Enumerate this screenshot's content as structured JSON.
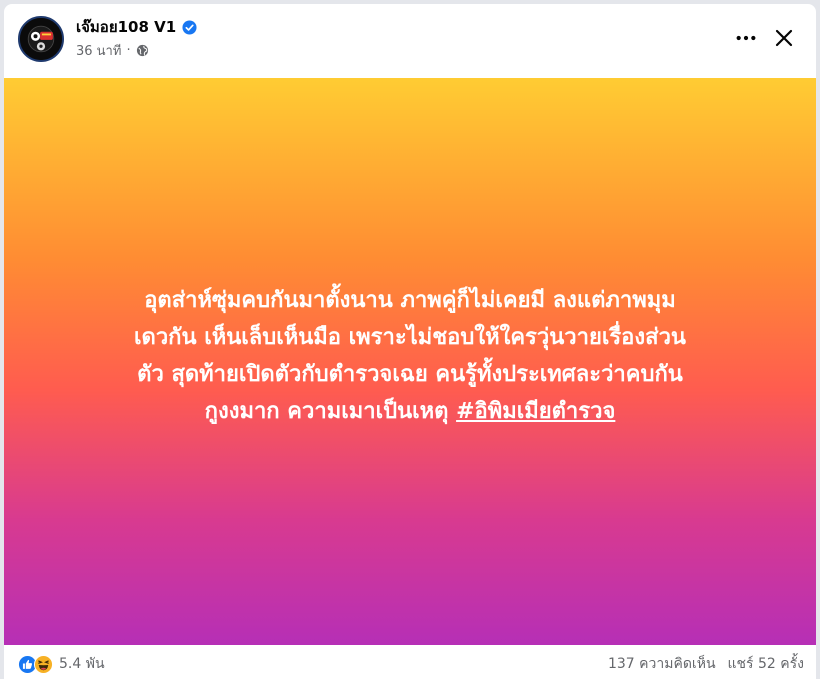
{
  "header": {
    "page_name": "เจ๊มอย108 V1",
    "time_ago": "36 นาที",
    "separator": "·",
    "verified_icon": "verified-badge-icon",
    "privacy_icon": "globe-icon",
    "more_icon": "more-options-icon",
    "close_icon": "close-icon"
  },
  "post": {
    "text_line_1": "อุตส่าห์ซุ่มคบกันมาตั้งนาน ภาพคู่ก็ไม่เคยมี ลงแต่ภาพมุม",
    "text_line_2": "เดวกัน เห็นเล็บเห็นมือ เพราะไม่ชอบให้ใครวุ่นวายเรื่องส่วน",
    "text_line_3": "ตัว สุดท้ายเปิดตัวกับตำรวจเฉย คนรู้ทั้งประเทศละว่าคบกัน",
    "text_line_4": "กูงงมาก ความเมาเป็นเหตุ ",
    "hashtag": "#อิพิมเมียตำรวจ",
    "colors": {
      "gradient_top": "#ffcc33",
      "gradient_mid": "#ff5c4f",
      "gradient_bottom": "#b62fb6",
      "text": "#ffffff"
    }
  },
  "footer": {
    "reaction_icons": [
      "like-icon",
      "haha-icon"
    ],
    "reaction_count": "5.4 พัน",
    "comments": "137 ความคิดเห็น",
    "shares": "แชร์ 52 ครั้ง"
  },
  "colors": {
    "verified_blue": "#1877f2",
    "secondary_text": "#65676b",
    "primary_text": "#050505"
  }
}
